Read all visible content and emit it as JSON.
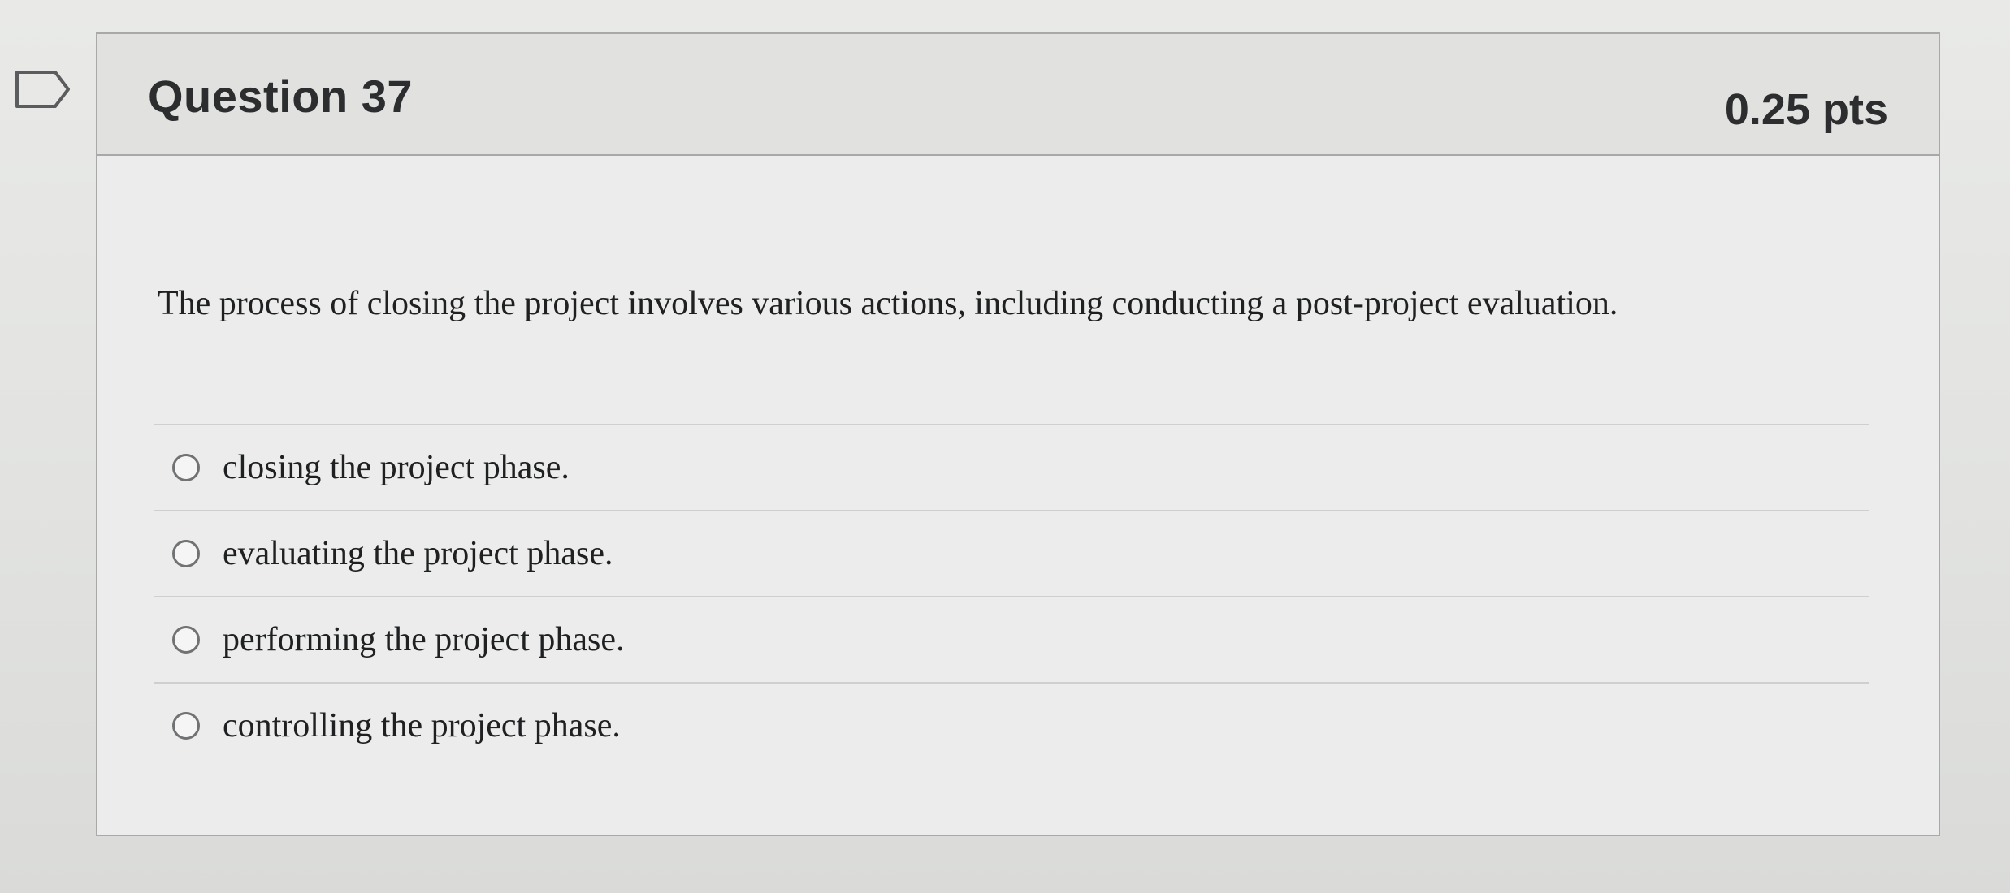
{
  "question": {
    "title": "Question 37",
    "points": "0.25 pts",
    "text": "The process of closing the project involves various actions, including conducting a post-project evaluation.",
    "answers": [
      {
        "label": "closing the project phase.",
        "selected": false
      },
      {
        "label": "evaluating the project phase.",
        "selected": false
      },
      {
        "label": "performing the project phase.",
        "selected": false
      },
      {
        "label": "controlling the project phase.",
        "selected": false
      }
    ]
  },
  "icons": {
    "bookmark": "bookmark-flag-icon"
  },
  "colors": {
    "header_background": "#e1e2e0",
    "card_background": "#ebeceb",
    "border": "#a9aaa8",
    "text": "#1f2022"
  }
}
